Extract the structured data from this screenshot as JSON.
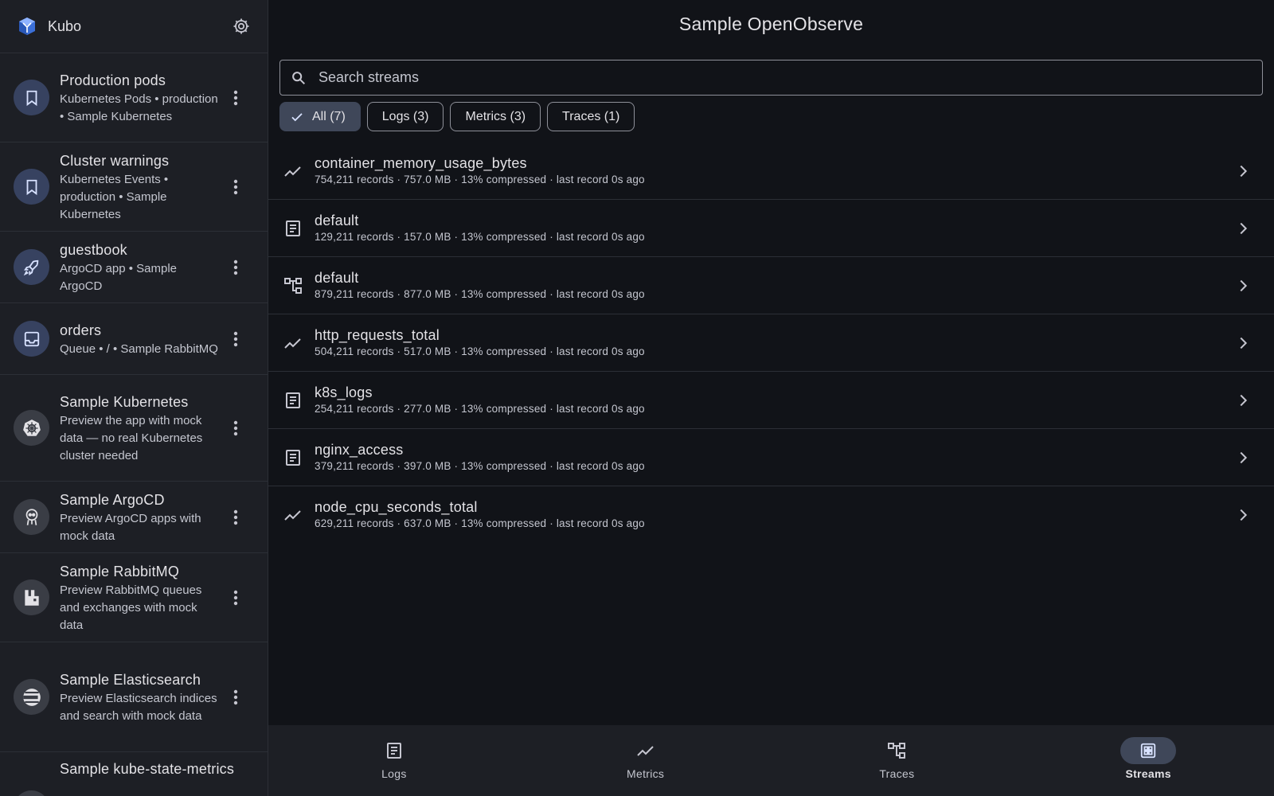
{
  "app": {
    "name": "Kubo"
  },
  "sidebar": {
    "items": [
      {
        "title": "Production pods",
        "subtitle": "Kubernetes Pods • production • Sample Kubernetes",
        "icon": "bookmark-icon"
      },
      {
        "title": "Cluster warnings",
        "subtitle": "Kubernetes Events • production • Sample Kubernetes",
        "icon": "bookmark-icon"
      },
      {
        "title": "guestbook",
        "subtitle": "ArgoCD app • Sample ArgoCD",
        "icon": "rocket-icon"
      },
      {
        "title": "orders",
        "subtitle": "Queue • / • Sample RabbitMQ",
        "icon": "inbox-icon"
      },
      {
        "title": "Sample Kubernetes",
        "subtitle": "Preview the app with mock data — no real Kubernetes cluster needed",
        "icon": "kubernetes-icon"
      },
      {
        "title": "Sample ArgoCD",
        "subtitle": "Preview ArgoCD apps with mock data",
        "icon": "argocd-icon"
      },
      {
        "title": "Sample RabbitMQ",
        "subtitle": "Preview RabbitMQ queues and exchanges with mock data",
        "icon": "rabbitmq-icon"
      },
      {
        "title": "Sample Elasticsearch",
        "subtitle": "Preview Elasticsearch indices and search with mock data",
        "icon": "elasticsearch-icon"
      },
      {
        "title": "Sample kube-state-metrics",
        "subtitle": "",
        "icon": "metrics-icon"
      }
    ]
  },
  "main": {
    "title": "Sample OpenObserve",
    "search": {
      "placeholder": "Search streams",
      "value": ""
    },
    "filters": [
      {
        "label": "All (7)",
        "selected": true
      },
      {
        "label": "Logs (3)",
        "selected": false
      },
      {
        "label": "Metrics (3)",
        "selected": false
      },
      {
        "label": "Traces (1)",
        "selected": false
      }
    ],
    "streams": [
      {
        "name": "container_memory_usage_bytes",
        "meta": "754,211 records · 757.0 MB · 13% compressed · last record 0s ago",
        "type": "metrics"
      },
      {
        "name": "default",
        "meta": "129,211 records · 157.0 MB · 13% compressed · last record 0s ago",
        "type": "logs"
      },
      {
        "name": "default",
        "meta": "879,211 records · 877.0 MB · 13% compressed · last record 0s ago",
        "type": "traces"
      },
      {
        "name": "http_requests_total",
        "meta": "504,211 records · 517.0 MB · 13% compressed · last record 0s ago",
        "type": "metrics"
      },
      {
        "name": "k8s_logs",
        "meta": "254,211 records · 277.0 MB · 13% compressed · last record 0s ago",
        "type": "logs"
      },
      {
        "name": "nginx_access",
        "meta": "379,211 records · 397.0 MB · 13% compressed · last record 0s ago",
        "type": "logs"
      },
      {
        "name": "node_cpu_seconds_total",
        "meta": "629,211 records · 637.0 MB · 13% compressed · last record 0s ago",
        "type": "metrics"
      }
    ]
  },
  "bottom_nav": {
    "items": [
      {
        "label": "Logs",
        "icon": "logs-icon",
        "active": false
      },
      {
        "label": "Metrics",
        "icon": "metrics-icon",
        "active": false
      },
      {
        "label": "Traces",
        "icon": "traces-icon",
        "active": false
      },
      {
        "label": "Streams",
        "icon": "streams-icon",
        "active": true
      }
    ]
  },
  "colors": {
    "background": "#111318",
    "surface": "#1d1f25",
    "accent": "#3f4759",
    "avatar": "#374260"
  }
}
